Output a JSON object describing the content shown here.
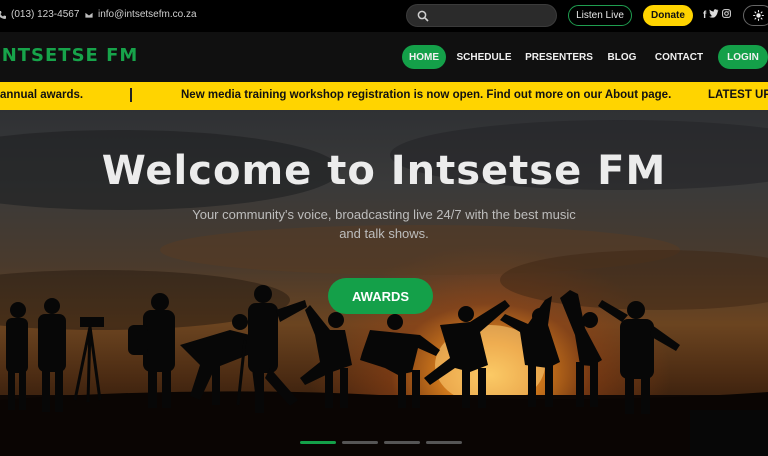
{
  "contact": {
    "phone": "(013) 123-4567",
    "email": "info@intsetsefm.co.za"
  },
  "search": {
    "placeholder": ""
  },
  "topbar": {
    "listen_live": "Listen Live",
    "donate": "Donate",
    "social_icons": [
      "facebook-icon",
      "twitter-icon",
      "instagram-icon"
    ],
    "theme_icon": "sun-icon"
  },
  "brand": {
    "name": "INTSETSE FM"
  },
  "nav": {
    "home": "HOME",
    "schedule": "SCHEDULE",
    "presenters": "PRESENTERS",
    "blog": "BLOG",
    "contact": "CONTACT",
    "login": "LOGIN"
  },
  "ticker": {
    "item1": "annual awards.",
    "item2": "New media training workshop registration is now open. Find out more on our About page.",
    "item3": "LATEST UP"
  },
  "hero": {
    "title": "Welcome to Intsetse FM",
    "subtitle": "Your community's voice, broadcasting live 24/7 with the best music and talk shows.",
    "cta": "AWARDS"
  },
  "carousel": {
    "slide_count": 4,
    "active_slide": 1
  },
  "colors": {
    "accent_green": "#14a049",
    "ticker_yellow": "#ffd400",
    "brand_green": "#17a34a"
  }
}
